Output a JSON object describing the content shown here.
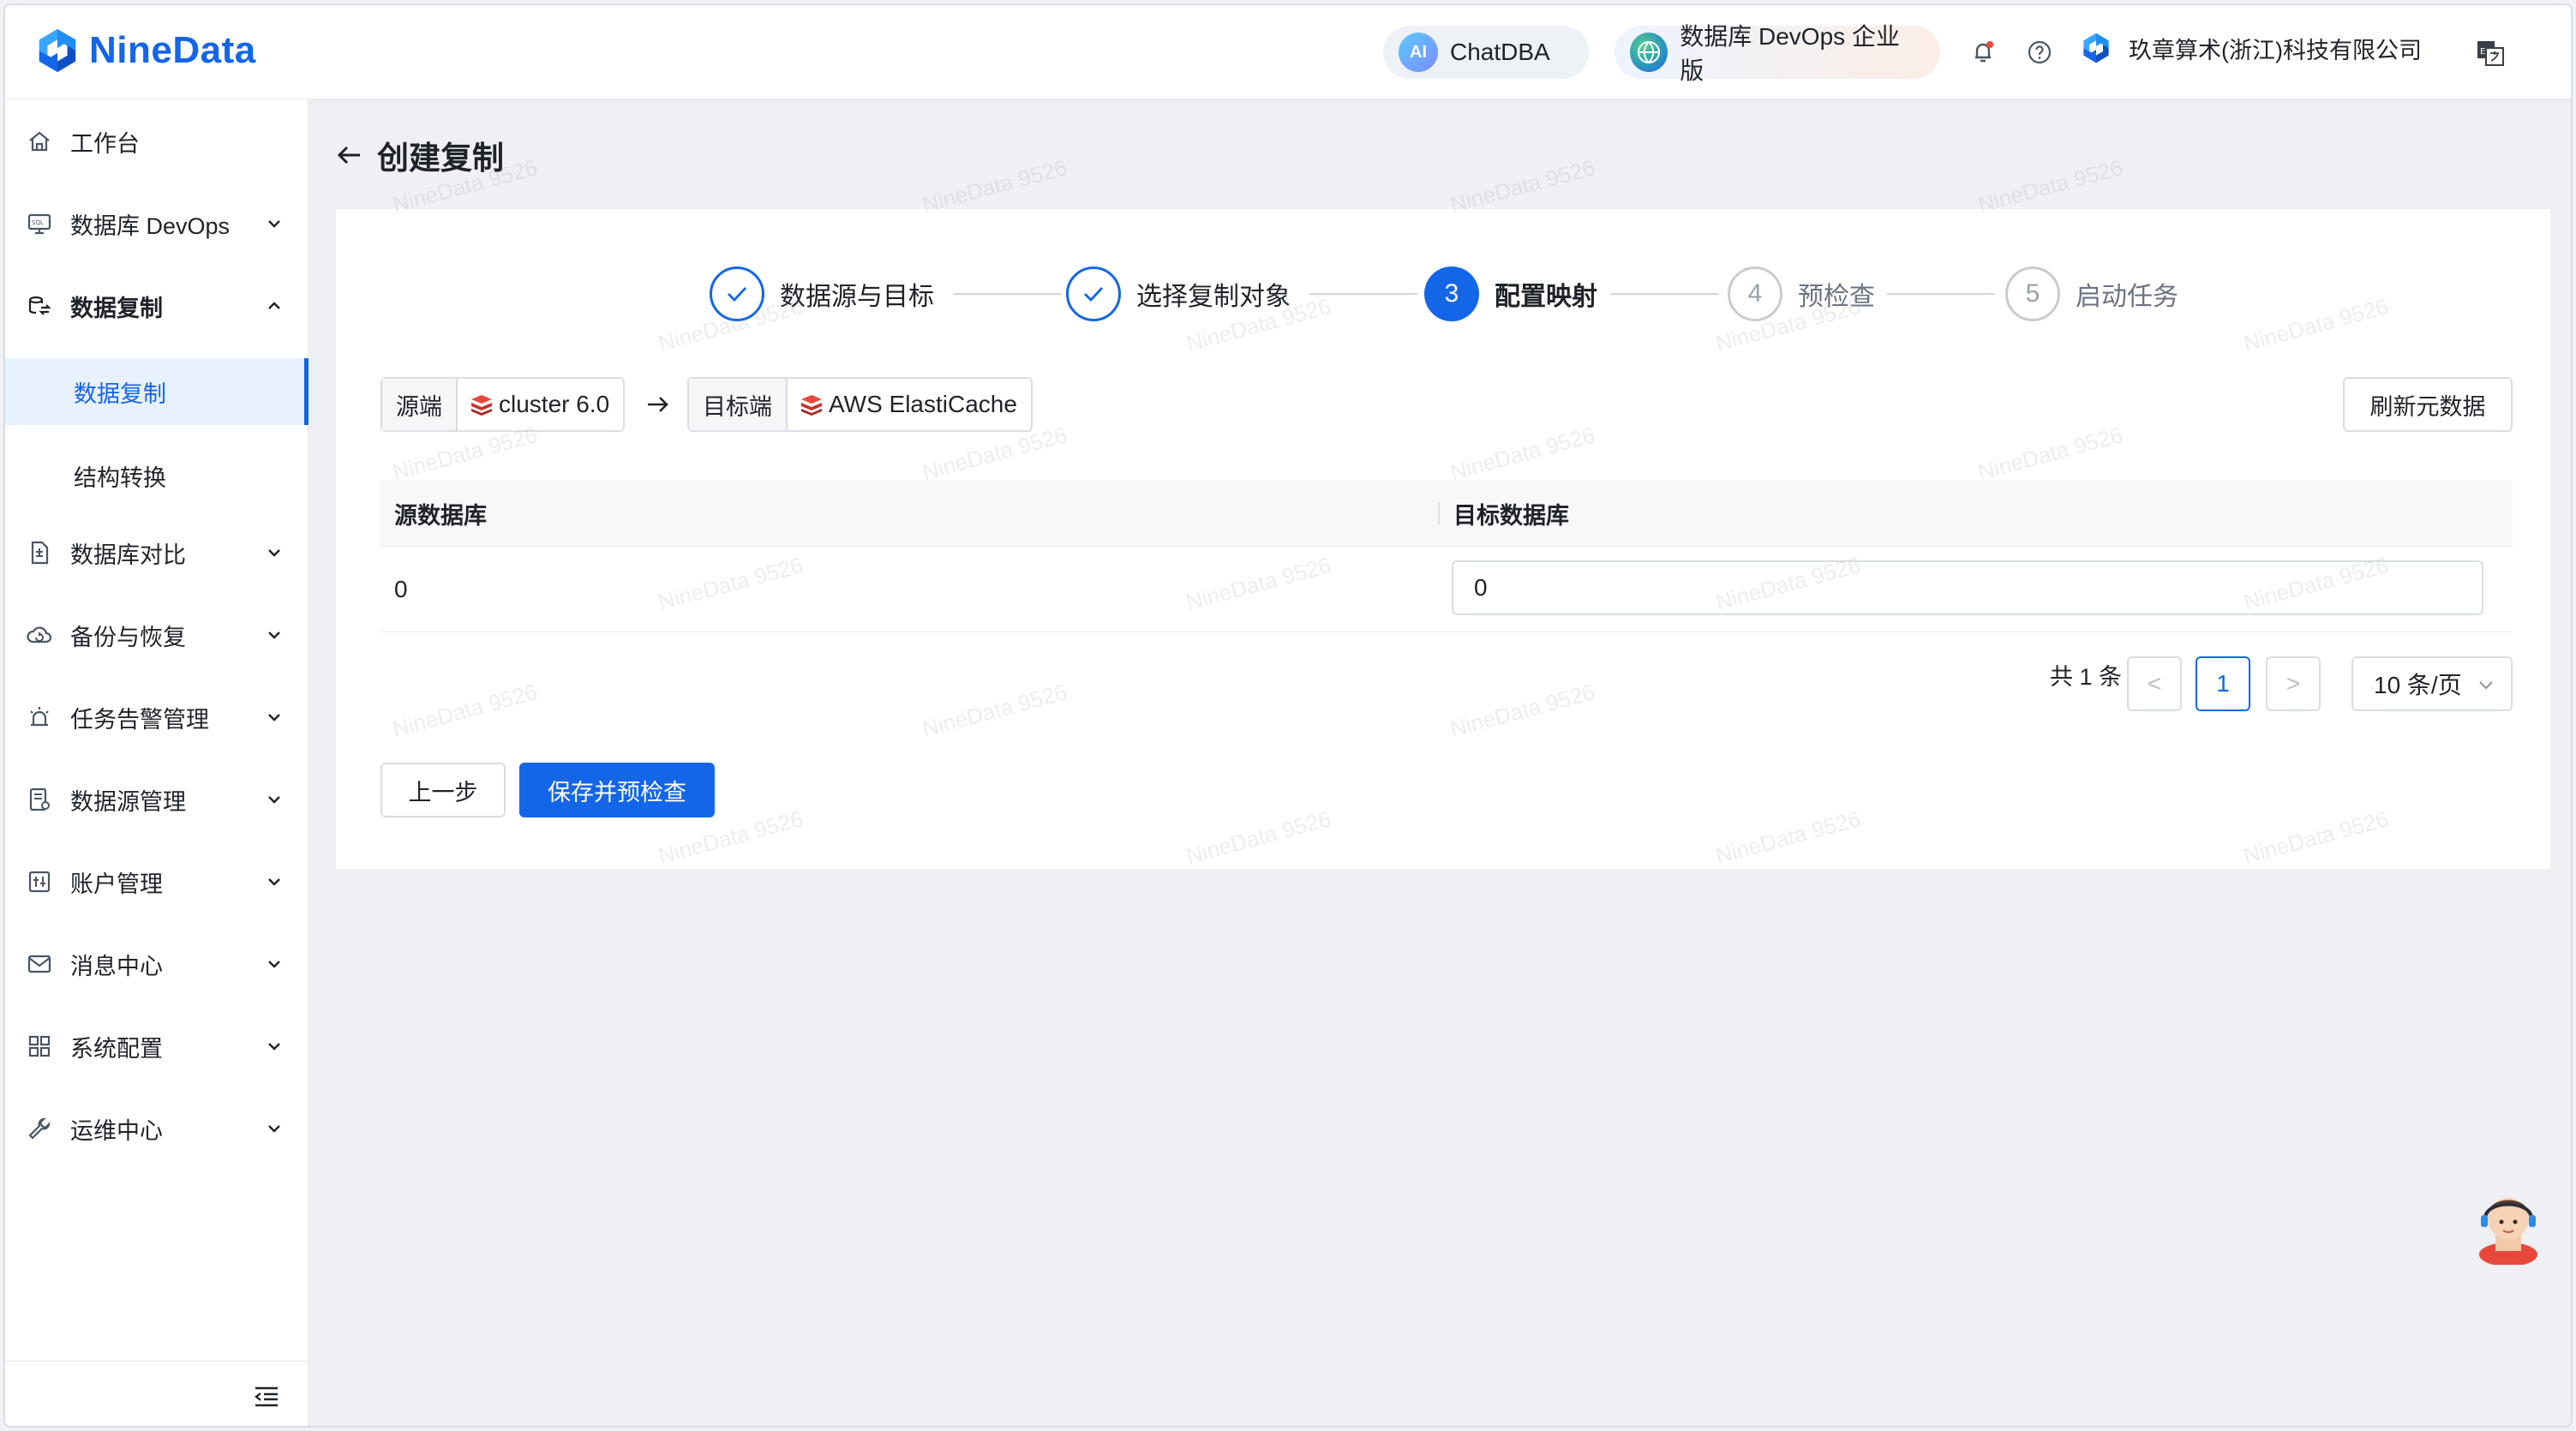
{
  "app": {
    "brand": "NineData",
    "chatdba_label": "ChatDBA",
    "edition_label": "数据库 DevOps 企业版",
    "company": "玖章算术(浙江)科技有限公司",
    "brand_color": "#1466e8"
  },
  "sidebar": {
    "items": [
      {
        "label": "工作台",
        "icon": "home-icon"
      },
      {
        "label": "数据库 DevOps",
        "icon": "sql-monitor-icon"
      },
      {
        "label": "数据复制",
        "icon": "replication-icon"
      },
      {
        "label": "数据复制",
        "icon": ""
      },
      {
        "label": "结构转换",
        "icon": ""
      },
      {
        "label": "数据库对比",
        "icon": "compare-icon"
      },
      {
        "label": "备份与恢复",
        "icon": "cloud-backup-icon"
      },
      {
        "label": "任务告警管理",
        "icon": "alarm-icon"
      },
      {
        "label": "数据源管理",
        "icon": "datasource-icon"
      },
      {
        "label": "账户管理",
        "icon": "account-icon"
      },
      {
        "label": "消息中心",
        "icon": "mail-icon"
      },
      {
        "label": "系统配置",
        "icon": "grid-icon"
      },
      {
        "label": "运维中心",
        "icon": "wrench-icon"
      }
    ]
  },
  "page": {
    "title": "创建复制",
    "steps": [
      {
        "label": "数据源与目标",
        "num": "",
        "status": "done"
      },
      {
        "label": "选择复制对象",
        "num": "",
        "status": "done"
      },
      {
        "label": "配置映射",
        "num": "3",
        "status": "active"
      },
      {
        "label": "预检查",
        "num": "4",
        "status": "todo"
      },
      {
        "label": "启动任务",
        "num": "5",
        "status": "todo"
      }
    ],
    "source_tag": "源端",
    "source_value": "cluster 6.0",
    "target_tag": "目标端",
    "target_value": "AWS ElastiCache",
    "refresh_label": "刷新元数据",
    "table": {
      "headers": [
        "源数据库",
        "目标数据库"
      ],
      "rows": [
        {
          "source": "0",
          "target": "0"
        }
      ]
    },
    "pagination": {
      "total": "共 1 条",
      "current": "1",
      "prev": "<",
      "next": ">",
      "page_size": "10 条/页"
    },
    "prev_label": "上一步",
    "save_label": "保存并预检查"
  },
  "watermark": "NineData 9526"
}
